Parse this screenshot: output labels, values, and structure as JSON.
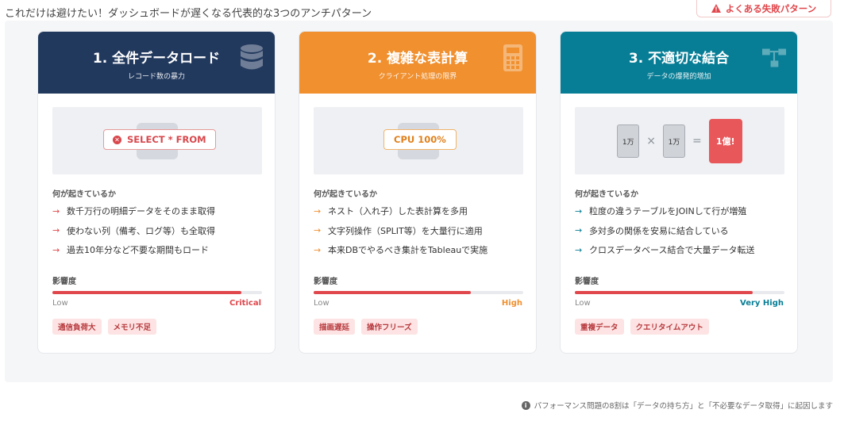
{
  "page": {
    "title": "これだけは避けたい！ダッシュボードが遅くなる代表的な3つのアンチパターン",
    "badge_label": "よくある失敗パターン",
    "footnote": "パフォーマンス問題の8割は「データの持ち方」と「不必要なデータ取得」に起因します"
  },
  "colors": {
    "navy": "#22395e",
    "orange": "#f0902f",
    "teal": "#087e96",
    "red": "#e0474c"
  },
  "cards": [
    {
      "title": "1. 全件データロード",
      "subtitle": "レコード数の暴力",
      "icon": "database-icon",
      "visual_text": "SELECT * FROM",
      "section_label": "何が起きているか",
      "bullets": [
        "数千万行の明細データをそのまま取得",
        "使わない列（備考、ログ等）も全取得",
        "過去10年分など不要な期間もロード"
      ],
      "impact_label": "影響度",
      "impact_level": 0.9,
      "scale_low": "Low",
      "scale_high": "Critical",
      "tags": [
        "通信負荷大",
        "メモリ不足"
      ]
    },
    {
      "title": "2. 複雑な表計算",
      "subtitle": "クライアント処理の限界",
      "icon": "calculator-icon",
      "visual_text": "CPU 100%",
      "section_label": "何が起きているか",
      "bullets": [
        "ネスト（入れ子）した表計算を多用",
        "文字列操作（SPLIT等）を大量行に適用",
        "本来DBでやるべき集計をTableauで実施"
      ],
      "impact_label": "影響度",
      "impact_level": 0.75,
      "scale_low": "Low",
      "scale_high": "High",
      "tags": [
        "描画遅延",
        "操作フリーズ"
      ]
    },
    {
      "title": "3. 不適切な結合",
      "subtitle": "データの爆発的増加",
      "icon": "sitemap-icon",
      "equation": {
        "left": "1万",
        "times": "×",
        "right": "1万",
        "equals": "=",
        "result": "1億!"
      },
      "section_label": "何が起きているか",
      "bullets": [
        "粒度の違うテーブルをJOINして行が増殖",
        "多対多の関係を安易に結合している",
        "クロスデータベース結合で大量データ転送"
      ],
      "impact_label": "影響度",
      "impact_level": 0.85,
      "scale_low": "Low",
      "scale_high": "Very High",
      "tags": [
        "重複データ",
        "クエリタイムアウト"
      ]
    }
  ]
}
